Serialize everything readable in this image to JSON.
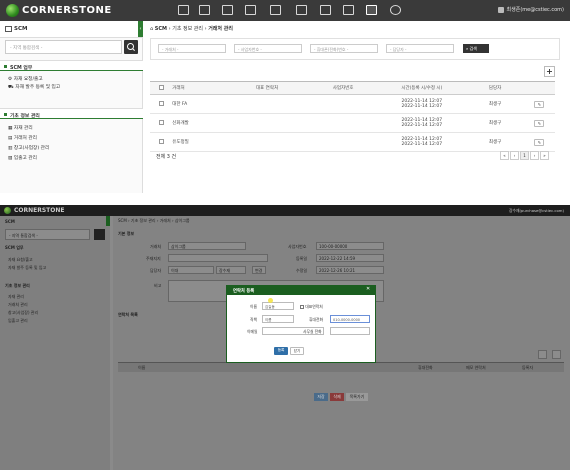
{
  "screen1": {
    "brand": "CORNERSTONE",
    "user": "최생존(me@cstiec.com)",
    "sidebar": {
      "title": "SCM",
      "search_placeholder": "- 지역 통합검색 -",
      "section1": "SCM 업무",
      "section1_items": [
        "자재 요청/출고",
        "자재 발주 등록 및 입고"
      ],
      "section2": "기초 정보 관리",
      "section2_items": [
        "자재 관리",
        "거래처 관리",
        "창고(사업장) 관리",
        "입출고 관리"
      ]
    },
    "breadcrumb": [
      "SCM",
      "기초 정보 관리",
      "거래처 관리"
    ],
    "filters": [
      "- 거래처 -",
      "- 사업자번호 -",
      "- 휴대폰(전화)번호 -",
      "- 담당자 -"
    ],
    "search_button": "검색",
    "table": {
      "headers": [
        "거래처",
        "대표 연락처",
        "사업자번호",
        "시간(등록 시/수정 시)",
        "담당자"
      ],
      "rows": [
        {
          "name": "대한 FA",
          "phone": "",
          "biz": "",
          "created": "2022-11-14 12:07",
          "modified": "2022-11-14 12:07",
          "manager": "최생구"
        },
        {
          "name": "신화개발",
          "phone": "",
          "biz": "",
          "created": "2022-11-14 12:07",
          "modified": "2022-11-14 12:07",
          "manager": "최생구"
        },
        {
          "name": "유도정밀",
          "phone": "",
          "biz": "",
          "created": "2022-11-14 12:07",
          "modified": "2022-11-14 12:07",
          "manager": "최생구"
        }
      ]
    },
    "total": "전체 3 건",
    "pager": [
      "«",
      "‹",
      "1",
      "›",
      "»"
    ]
  },
  "screen2": {
    "brand": "CORNERSTONE",
    "user": "장수재(purchase@cstiec.com)",
    "sidebar_title": "SCM",
    "search_placeholder": "- 지역 통합검색 -",
    "section1": "SCM 업무",
    "section1_items": [
      "자재 요청/출고",
      "자재 발주 등록 및 입고"
    ],
    "section2": "기초 정보 관리",
    "section2_items": [
      "자재 관리",
      "거래처 관리",
      "창고(사업장) 관리",
      "입출고 관리"
    ],
    "breadcrumb": "SCM › 기초 정보 관리 › 거래처 › 삼이그룹",
    "section_basic": "기본 정보",
    "form": {
      "company_label": "거래처",
      "company_value": "삼이그룹",
      "biz_label": "사업자번호",
      "biz_value": "100-00-00000",
      "address_label": "주재지지",
      "reg_label": "등록일",
      "reg_value": "2022-12-22 14:59",
      "manager_label": "담당자",
      "manager_value": "이대",
      "manager_btn1": "장수재",
      "manager_btn2": "변경",
      "mod_label": "수정일",
      "mod_value": "2022-12-26 10:21",
      "memo_label": "비고"
    },
    "section_contacts": "연락처 목록",
    "list_headers": [
      "이름",
      "휴대전화",
      "메모 연락처",
      "등록자"
    ],
    "bottom_buttons": [
      "저장",
      "삭제",
      "목록가기"
    ],
    "modal": {
      "title": "연락처 등록",
      "close": "✕",
      "name_label": "이름",
      "name_value": "김길동",
      "rep_checkbox": "대표연락처",
      "title_label": "직책",
      "title_value": "이름",
      "phone_label": "휴대전화",
      "phone_value": "010-0000-0000",
      "email_label": "이메일",
      "ext_label": "사무실 전화",
      "save": "등록",
      "cancel": "닫기"
    }
  }
}
